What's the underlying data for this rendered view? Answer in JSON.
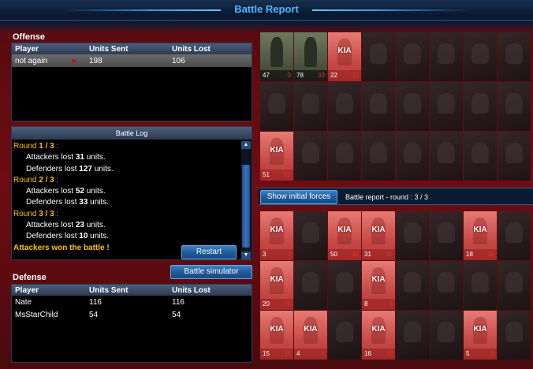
{
  "window": {
    "title": "Battle Report"
  },
  "offense": {
    "heading": "Offense",
    "columns": [
      "Player",
      "Units Sent",
      "Units Lost"
    ],
    "rows": [
      {
        "player": "not again",
        "sent": "198",
        "lost": "106"
      }
    ]
  },
  "battle_log": {
    "header": "Battle Log",
    "rounds": [
      {
        "label_pre": "Round ",
        "label_bold": "1 / 3",
        "label_post": " :",
        "att_pre": "Attackers lost ",
        "att_num": "31",
        "att_post": " units.",
        "def_pre": "Defenders lost ",
        "def_num": "127",
        "def_post": " units."
      },
      {
        "label_pre": "Round ",
        "label_bold": "2 / 3",
        "label_post": " :",
        "att_pre": "Attackers lost ",
        "att_num": "52",
        "att_post": " units.",
        "def_pre": "Defenders lost ",
        "def_num": "33",
        "def_post": " units."
      },
      {
        "label_pre": "Round ",
        "label_bold": "3 / 3",
        "label_post": " :",
        "att_pre": "Attackers lost ",
        "att_num": "23",
        "att_post": " units.",
        "def_pre": "Defenders lost ",
        "def_num": "10",
        "def_post": " units."
      }
    ],
    "result": "Attackers won the battle !",
    "restart_label": "Restart"
  },
  "simulator_label": "Battle simulator",
  "defense": {
    "heading": "Defense",
    "columns": [
      "Player",
      "Units Sent",
      "Units Lost"
    ],
    "rows": [
      {
        "player": "Nate",
        "sent": "116",
        "lost": "116"
      },
      {
        "player": "MsStarChild",
        "sent": "54",
        "lost": "54"
      }
    ]
  },
  "report_bar": {
    "show_initial_label": "Show initial forces",
    "round_label": "Battle report - round : 3 / 3"
  },
  "kia_text": "KIA",
  "offense_units": [
    {
      "state": "live",
      "count": "47",
      "lost": "0"
    },
    {
      "state": "live",
      "count": "78",
      "lost": "33"
    },
    {
      "state": "kia",
      "count": "22",
      "lost": "22"
    },
    {
      "state": "dim"
    },
    {
      "state": "dim"
    },
    {
      "state": "dim"
    },
    {
      "state": "dim"
    },
    {
      "state": "dim"
    },
    {
      "state": "dim"
    },
    {
      "state": "dim"
    },
    {
      "state": "dim"
    },
    {
      "state": "dim"
    },
    {
      "state": "dim"
    },
    {
      "state": "dim"
    },
    {
      "state": "dim"
    },
    {
      "state": "dim"
    },
    {
      "state": "kia",
      "count": "51",
      "lost": "51"
    },
    {
      "state": "dim"
    },
    {
      "state": "dim"
    },
    {
      "state": "dim"
    },
    {
      "state": "dim"
    },
    {
      "state": "dim"
    },
    {
      "state": "dim"
    },
    {
      "state": "dim"
    }
  ],
  "defense_units": [
    {
      "state": "kia",
      "count": "3",
      "lost": "3"
    },
    {
      "state": "dim"
    },
    {
      "state": "kia",
      "count": "50",
      "lost": "50"
    },
    {
      "state": "kia",
      "count": "31",
      "lost": "31"
    },
    {
      "state": "dim"
    },
    {
      "state": "dim"
    },
    {
      "state": "kia",
      "count": "18",
      "lost": "18"
    },
    {
      "state": "dim"
    },
    {
      "state": "kia",
      "count": "20",
      "lost": "20"
    },
    {
      "state": "dim"
    },
    {
      "state": "dim"
    },
    {
      "state": "kia",
      "count": "8",
      "lost": "8"
    },
    {
      "state": "dim"
    },
    {
      "state": "dim"
    },
    {
      "state": "dim"
    },
    {
      "state": "dim"
    },
    {
      "state": "kia",
      "count": "15",
      "lost": "15"
    },
    {
      "state": "kia",
      "count": "4",
      "lost": "4"
    },
    {
      "state": "dim"
    },
    {
      "state": "kia",
      "count": "16",
      "lost": "16"
    },
    {
      "state": "dim"
    },
    {
      "state": "dim"
    },
    {
      "state": "kia",
      "count": "5",
      "lost": "5"
    },
    {
      "state": "dim"
    }
  ],
  "colors": {
    "accent": "#4fb6ff",
    "highlight": "#ffbf00",
    "kia": "#c84a46",
    "loss": "#e0302a"
  }
}
